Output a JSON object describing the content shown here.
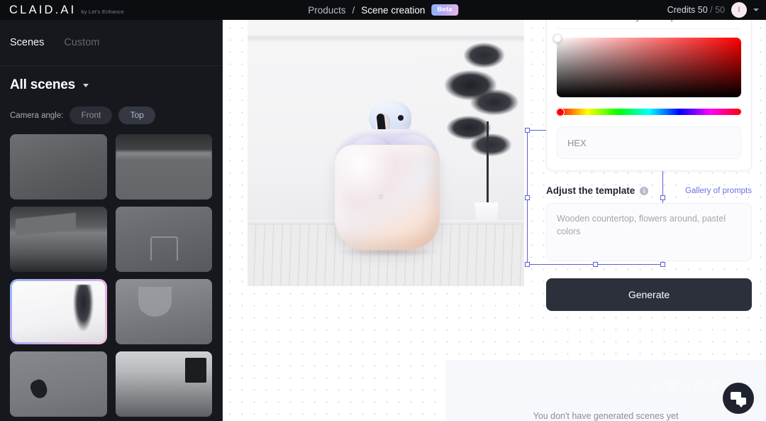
{
  "header": {
    "brand_name": "CLAID.AI",
    "brand_tagline": "by Let's Enhance",
    "breadcrumb_root": "Products",
    "breadcrumb_separator": "/",
    "breadcrumb_current": "Scene creation",
    "beta_badge": "Beta",
    "credits_label": "Credits 50",
    "credits_total": "/ 50",
    "avatar_initial": "I",
    "accent_beta_gradient": "#b3a7f2"
  },
  "sidebar": {
    "tabs": [
      {
        "label": "Scenes",
        "active": true
      },
      {
        "label": "Custom",
        "active": false
      }
    ],
    "section_title": "All scenes",
    "camera_angle_label": "Camera angle:",
    "camera_angles": [
      {
        "label": "Front",
        "active": false
      },
      {
        "label": "Top",
        "active": true
      }
    ],
    "thumbnails": [
      {
        "name": "plain-grey-studio",
        "selected": false
      },
      {
        "name": "stone-ledge",
        "selected": false
      },
      {
        "name": "concrete-steps",
        "selected": false
      },
      {
        "name": "chair-interior",
        "selected": false
      },
      {
        "name": "white-room-with-plant",
        "selected": true
      },
      {
        "name": "wine-glass-wall",
        "selected": false
      },
      {
        "name": "dark-object-table",
        "selected": false
      },
      {
        "name": "kitchen-counter",
        "selected": false
      }
    ],
    "selected_border_gradient": "#b9a9ef"
  },
  "canvas": {
    "product_name": "airpods-case",
    "selection_color": "#5b5fd6",
    "handle_count": 8
  },
  "right_panel": {
    "color_picker_caption": "Choose the color for your composition",
    "hex_placeholder": "HEX",
    "hue_value_color": "#ff0000",
    "adjust_title": "Adjust the template",
    "gallery_link": "Gallery of prompts",
    "prompt_placeholder": "Wooden countertop, flowers around, pastel colors",
    "generate_label": "Generate",
    "generate_bg": "#2c303b",
    "link_color": "#6d6ee0"
  },
  "bottom": {
    "empty_state_text": "You don't have generated scenes yet",
    "watermark_text": "运营有道理"
  }
}
